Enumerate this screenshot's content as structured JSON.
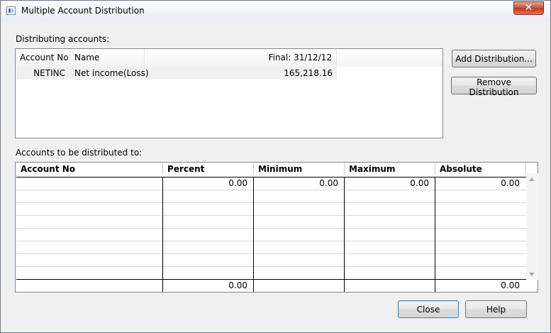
{
  "window": {
    "title": "Multiple Account Distribution",
    "close_glyph": "✕"
  },
  "distributing": {
    "label": "Distributing accounts:",
    "headers": {
      "account_no": "Account No",
      "name": "Name",
      "final": "Final:  31/12/12"
    },
    "rows": [
      {
        "account_no": "NETINC",
        "name": "Net income(Loss)",
        "final": "165,218.16"
      }
    ]
  },
  "buttons": {
    "add": "Add Distribution...",
    "remove": "Remove Distribution",
    "close": "Close",
    "help": "Help"
  },
  "targets": {
    "label": "Accounts to be distributed to:",
    "headers": {
      "account_no": "Account No",
      "percent": "Percent",
      "minimum": "Minimum",
      "maximum": "Maximum",
      "absolute": "Absolute"
    },
    "first_row": {
      "account_no": "",
      "percent": "0.00",
      "minimum": "0.00",
      "maximum": "0.00",
      "absolute": "0.00"
    },
    "totals": {
      "percent": "0.00",
      "minimum": "",
      "maximum": "",
      "absolute": "0.00"
    }
  }
}
